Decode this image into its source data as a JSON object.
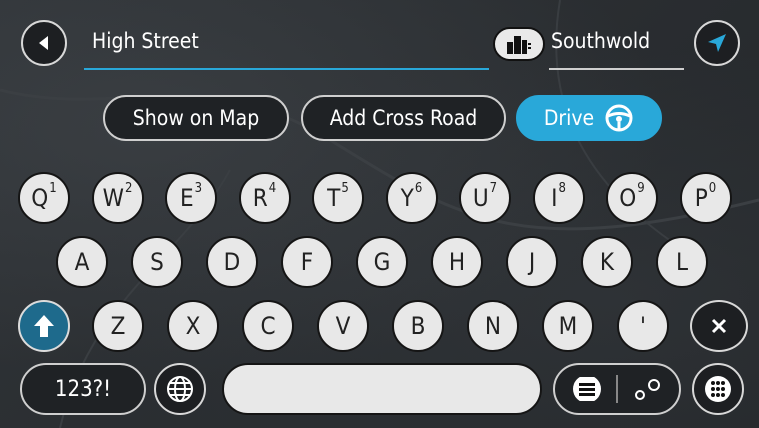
{
  "search": {
    "query": "High Street",
    "city": "Southwold"
  },
  "actions": {
    "show_on_map": "Show on Map",
    "add_cross_road": "Add Cross Road",
    "drive": "Drive"
  },
  "keyboard": {
    "row1": [
      {
        "letter": "Q",
        "digit": "1"
      },
      {
        "letter": "W",
        "digit": "2"
      },
      {
        "letter": "E",
        "digit": "3"
      },
      {
        "letter": "R",
        "digit": "4"
      },
      {
        "letter": "T",
        "digit": "5"
      },
      {
        "letter": "Y",
        "digit": "6"
      },
      {
        "letter": "U",
        "digit": "7"
      },
      {
        "letter": "I",
        "digit": "8"
      },
      {
        "letter": "O",
        "digit": "9"
      },
      {
        "letter": "P",
        "digit": "0"
      }
    ],
    "row2": [
      "A",
      "S",
      "D",
      "F",
      "G",
      "H",
      "J",
      "K",
      "L"
    ],
    "row3": [
      "Z",
      "X",
      "C",
      "V",
      "B",
      "N",
      "M",
      "'"
    ],
    "mode_key": "123?!"
  },
  "colors": {
    "accent": "#29a8d9",
    "shift": "#1e6a8c",
    "key_face": "#e8e8e8"
  },
  "icons": {
    "back": "back-arrow-icon",
    "city": "city-buildings-icon",
    "location": "current-location-arrow-icon",
    "steering": "steering-wheel-icon",
    "shift": "shift-arrow-icon",
    "backspace": "backspace-icon",
    "globe": "globe-icon",
    "list": "list-icon",
    "route": "route-icon",
    "keypad": "keypad-icon"
  }
}
